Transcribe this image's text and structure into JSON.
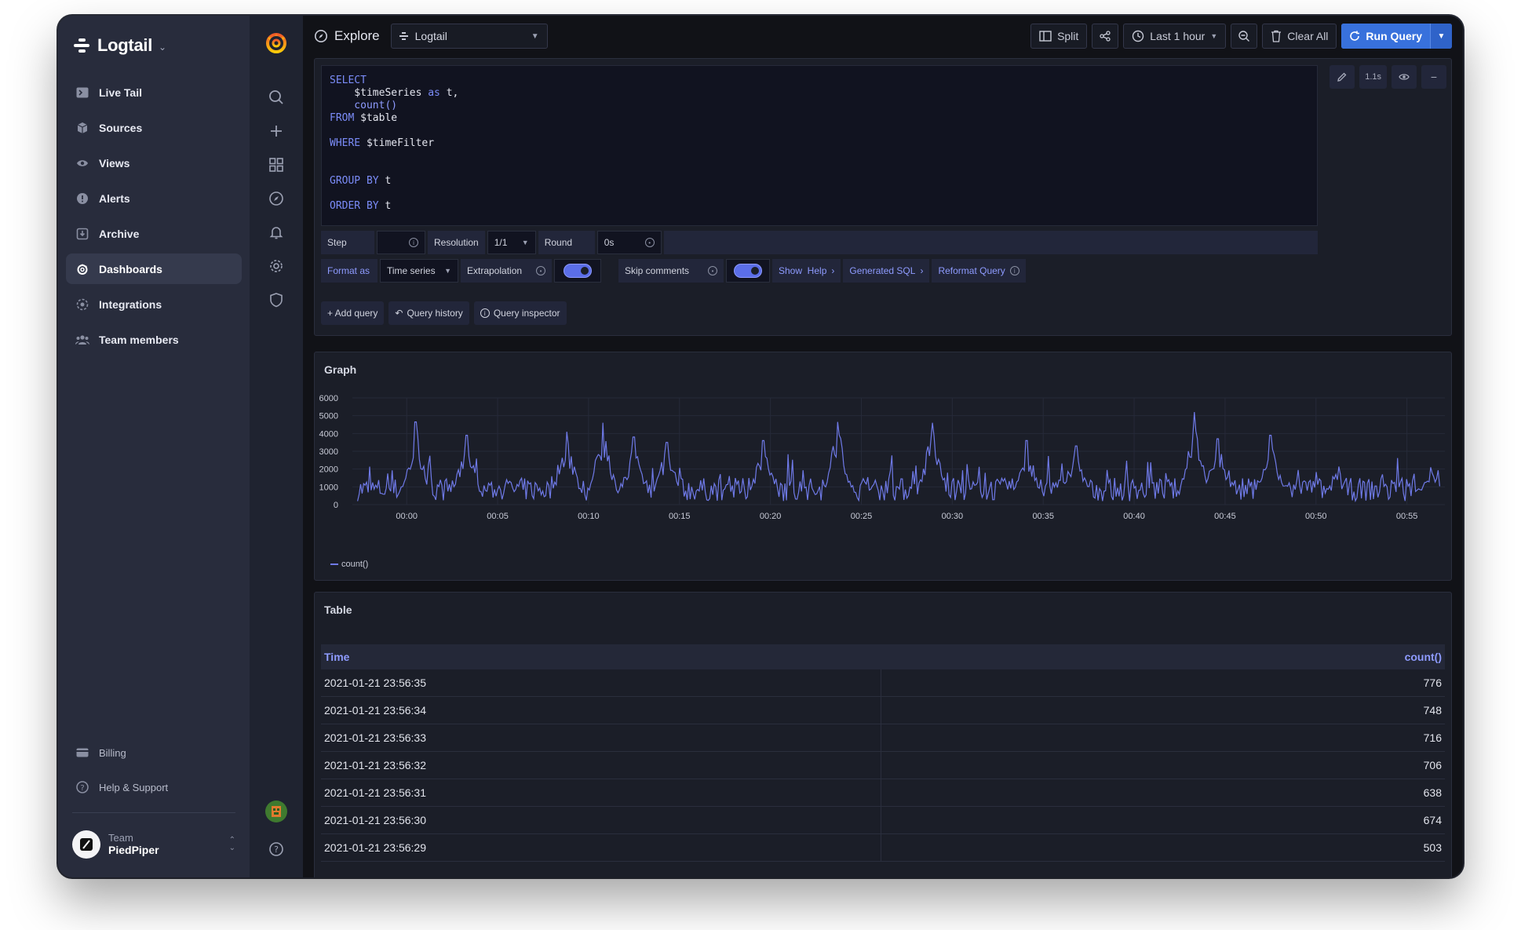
{
  "brand": {
    "name": "Logtail"
  },
  "nav": {
    "items": [
      {
        "label": "Live Tail",
        "icon": "terminal-icon"
      },
      {
        "label": "Sources",
        "icon": "cube-icon"
      },
      {
        "label": "Views",
        "icon": "eye-icon"
      },
      {
        "label": "Alerts",
        "icon": "alert-icon"
      },
      {
        "label": "Archive",
        "icon": "archive-icon"
      },
      {
        "label": "Dashboards",
        "icon": "grafana-icon",
        "active": true
      },
      {
        "label": "Integrations",
        "icon": "integrations-icon"
      },
      {
        "label": "Team members",
        "icon": "team-icon"
      }
    ],
    "bottom": [
      {
        "label": "Billing",
        "icon": "card-icon"
      },
      {
        "label": "Help & Support",
        "icon": "help-icon"
      }
    ]
  },
  "team": {
    "label": "Team",
    "name": "PiedPiper"
  },
  "header": {
    "title": "Explore",
    "datasource": "Logtail",
    "split_label": "Split",
    "time_range": "Last 1 hour",
    "clear_label": "Clear All",
    "run_label": "Run Query"
  },
  "query": {
    "lines": [
      {
        "kw": "SELECT",
        "rest": ""
      },
      {
        "kw": "",
        "rest": "    $timeSeries ",
        "kw2": "as",
        "rest2": " t,"
      },
      {
        "kw": "",
        "fn": "    count()"
      },
      {
        "kw": "FROM",
        "rest": " $table"
      },
      {
        "gap": true
      },
      {
        "kw": "WHERE",
        "rest": " $timeFilter"
      },
      {
        "gap": true
      },
      {
        "gap": true
      },
      {
        "kw": "GROUP BY",
        "rest": " t"
      },
      {
        "gap": true
      },
      {
        "kw": "ORDER BY",
        "rest": " t"
      }
    ],
    "duration": "1.1s",
    "step_label": "Step",
    "resolution_label": "Resolution",
    "resolution_value": "1/1",
    "round_label": "Round",
    "round_value": "0s",
    "format_label": "Format as",
    "format_value": "Time series",
    "extrapolation_label": "Extrapolation",
    "skip_comments_label": "Skip comments",
    "show_help_label": "Show  Help",
    "generated_sql_label": "Generated SQL",
    "reformat_label": "Reformat Query",
    "add_query_label": "+ Add query",
    "history_label": "Query history",
    "inspector_label": "Query inspector"
  },
  "colors": {
    "series": "#6f7ae8",
    "accent": "#3871dc"
  },
  "chart_data": {
    "type": "line",
    "title": "Graph",
    "ylim": [
      0,
      6000
    ],
    "yticks": [
      "6000",
      "5000",
      "4000",
      "3000",
      "2000",
      "1000",
      "0"
    ],
    "xticks": [
      "00:00",
      "00:05",
      "00:10",
      "00:15",
      "00:20",
      "00:25",
      "00:30",
      "00:35",
      "00:40",
      "00:45",
      "00:50",
      "00:55"
    ],
    "series": [
      {
        "name": "count()",
        "color": "#6f7ae8",
        "peaks": [
          {
            "t": 0.5,
            "v": 4650
          },
          {
            "t": 3.3,
            "v": 3900
          },
          {
            "t": 8.8,
            "v": 4100
          },
          {
            "t": 10.8,
            "v": 4600
          },
          {
            "t": 12.5,
            "v": 3800
          },
          {
            "t": 14.3,
            "v": 3500
          },
          {
            "t": 19.6,
            "v": 3600
          },
          {
            "t": 23.7,
            "v": 4650
          },
          {
            "t": 28.9,
            "v": 4600
          },
          {
            "t": 34.1,
            "v": 3600
          },
          {
            "t": 36.8,
            "v": 3300
          },
          {
            "t": 43.3,
            "v": 5200
          },
          {
            "t": 44.6,
            "v": 3700
          },
          {
            "t": 47.5,
            "v": 3900
          },
          {
            "t": 56.3,
            "v": 2100
          }
        ],
        "baseline": [
          200,
          1500
        ]
      }
    ]
  },
  "table": {
    "title": "Table",
    "columns": [
      "Time",
      "count()"
    ],
    "rows": [
      [
        "2021-01-21 23:56:35",
        "776"
      ],
      [
        "2021-01-21 23:56:34",
        "748"
      ],
      [
        "2021-01-21 23:56:33",
        "716"
      ],
      [
        "2021-01-21 23:56:32",
        "706"
      ],
      [
        "2021-01-21 23:56:31",
        "638"
      ],
      [
        "2021-01-21 23:56:30",
        "674"
      ],
      [
        "2021-01-21 23:56:29",
        "503"
      ]
    ]
  }
}
